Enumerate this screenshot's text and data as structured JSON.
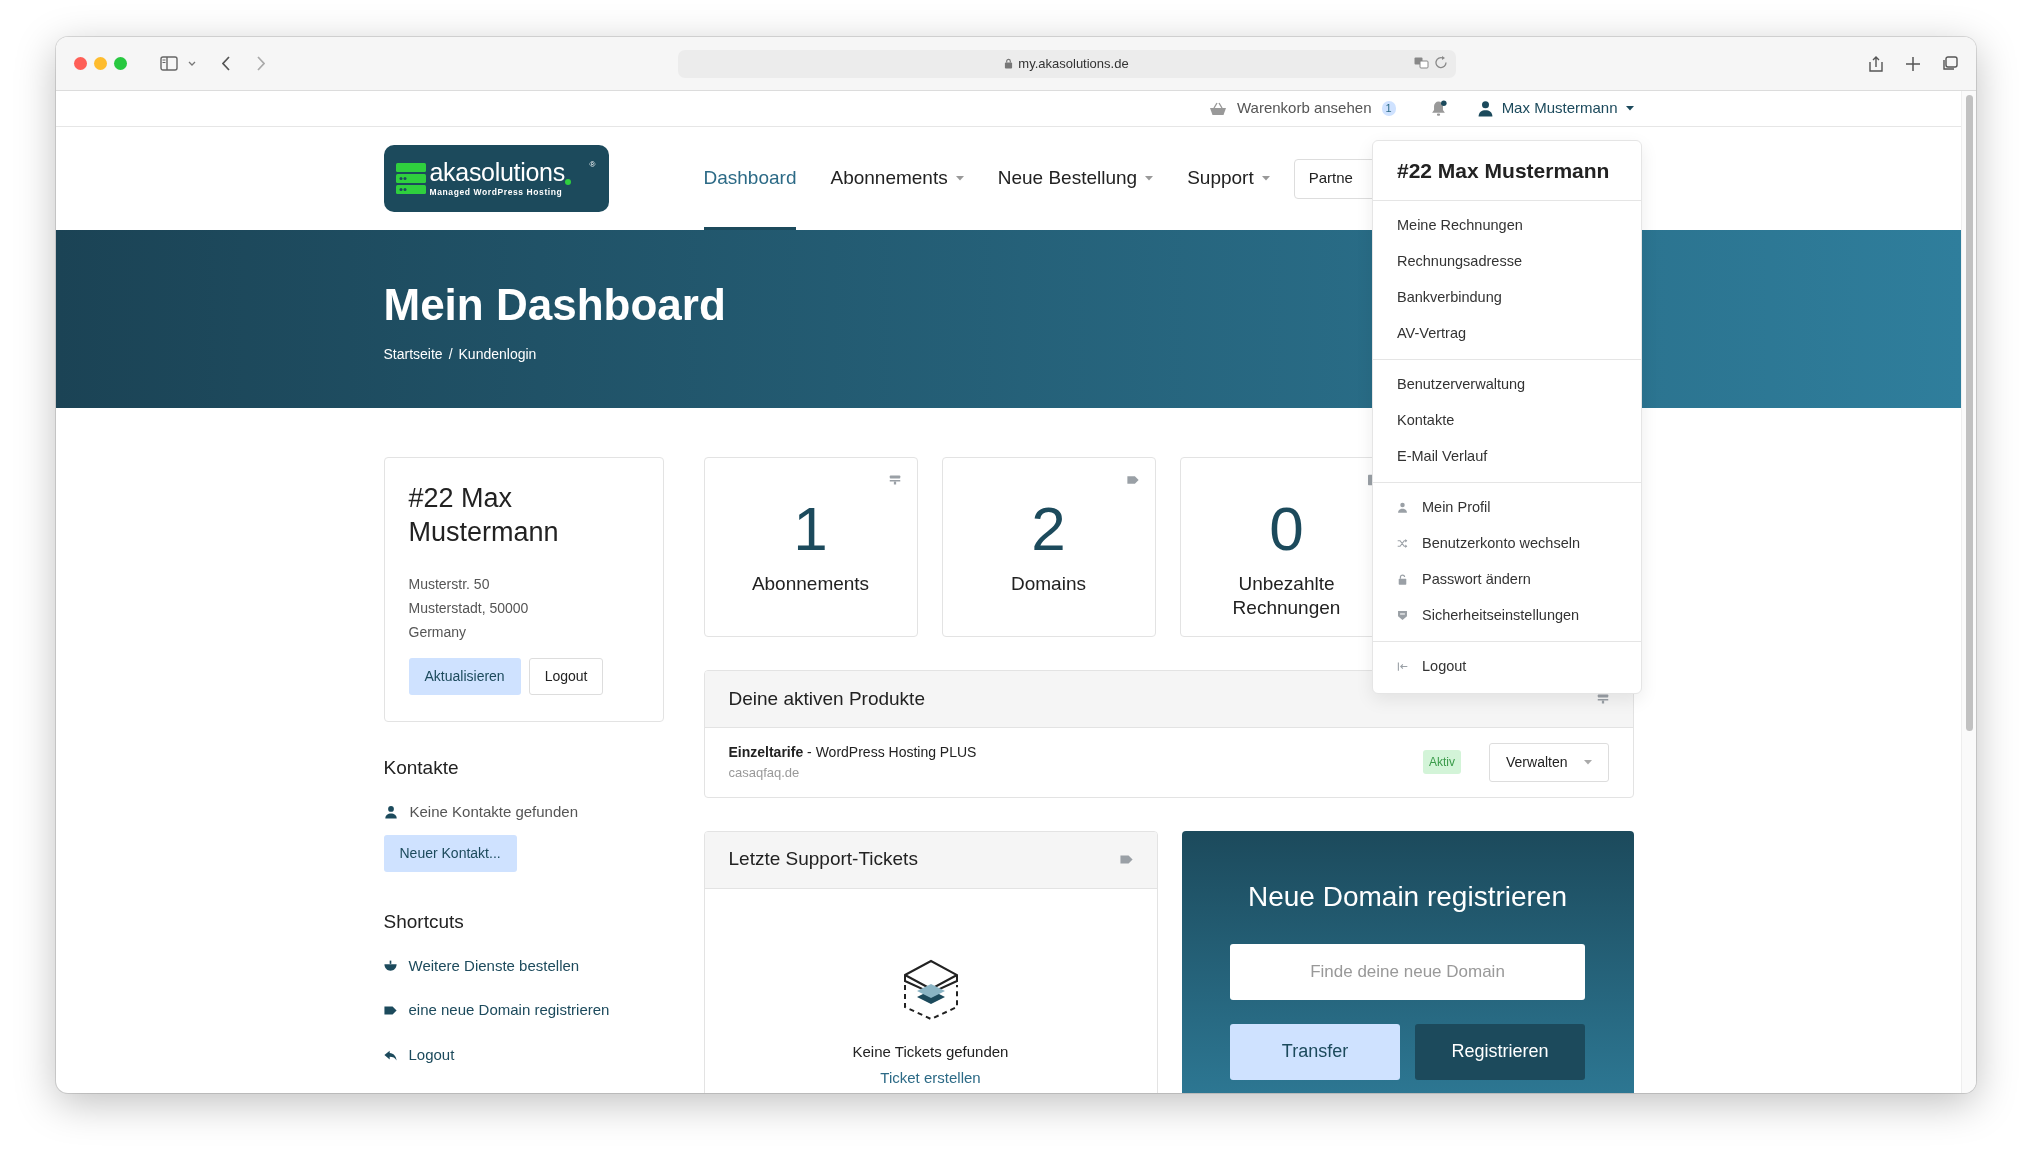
{
  "browser": {
    "url": "my.akasolutions.de"
  },
  "topbar": {
    "cart_label": "Warenkorb ansehen",
    "cart_count": "1",
    "user_name": "Max Mustermann"
  },
  "logo": {
    "name": "akasolutions",
    "registered": "®",
    "tagline": "Managed WordPress Hosting"
  },
  "nav": [
    {
      "label": "Dashboard",
      "selected": true,
      "dropdown": false
    },
    {
      "label": "Abonnements",
      "selected": false,
      "dropdown": true
    },
    {
      "label": "Neue Bestellung",
      "selected": false,
      "dropdown": true
    },
    {
      "label": "Support",
      "selected": false,
      "dropdown": true
    }
  ],
  "partner_button": "Partne",
  "hero": {
    "title": "Mein Dashboard",
    "breadcrumb": [
      "Startseite",
      "Kundenlogin"
    ],
    "separator": "/"
  },
  "profile": {
    "name": "#22 Max Mustermann",
    "address": [
      "Musterstr. 50",
      "Musterstadt, 50000",
      "Germany"
    ],
    "buttons": [
      {
        "label": "Aktualisieren",
        "kind": "primary"
      },
      {
        "label": "Logout",
        "kind": "outline"
      }
    ]
  },
  "contacts": {
    "title": "Kontakte",
    "empty": "Keine Kontakte gefunden",
    "button": "Neuer Kontakt..."
  },
  "shortcuts": {
    "title": "Shortcuts",
    "items": [
      {
        "label": "Weitere Dienste bestellen",
        "kind": "basket"
      },
      {
        "label": "eine neue Domain registrieren",
        "kind": "tag"
      },
      {
        "label": "Logout",
        "kind": "reply"
      }
    ]
  },
  "stats": [
    {
      "value": "1",
      "label": "Abonnements",
      "kind": "server"
    },
    {
      "value": "2",
      "label": "Domains",
      "kind": "tag"
    },
    {
      "value": "0",
      "label": "Unbezahlte Rechnungen",
      "kind": "doc"
    }
  ],
  "products": {
    "title": "Deine aktiven Produkte",
    "items": [
      {
        "name": "**Einzeltarife** - WordPress Hosting PLUS",
        "domain": "casaqfaq.de",
        "status": "Aktiv",
        "action": "Verwalten"
      }
    ]
  },
  "tickets": {
    "title": "Letzte Support-Tickets",
    "empty": "Keine Tickets gefunden",
    "link": "Ticket erstellen"
  },
  "domain": {
    "title": "Neue Domain registrieren",
    "placeholder": "Finde deine neue Domain",
    "buttons": [
      {
        "label": "Transfer",
        "kind": "light"
      },
      {
        "label": "Registrieren",
        "kind": "dark"
      }
    ]
  },
  "user_menu": {
    "title": "#22 Max Mustermann",
    "groups": [
      {
        "items": [
          {
            "label": "Meine Rechnungen"
          },
          {
            "label": "Rechnungsadresse"
          },
          {
            "label": "Bankverbindung"
          },
          {
            "label": "AV-Vertrag"
          }
        ]
      },
      {
        "items": [
          {
            "label": "Benutzerverwaltung"
          },
          {
            "label": "Kontakte"
          },
          {
            "label": "E-Mail Verlauf"
          }
        ]
      },
      {
        "items": [
          {
            "label": "Mein Profil",
            "kind": "user"
          },
          {
            "label": "Benutzerkonto wechseln",
            "kind": "shuffle"
          },
          {
            "label": "Passwort ändern",
            "kind": "lock"
          },
          {
            "label": "Sicherheitseinstellungen",
            "kind": "shield"
          }
        ]
      },
      {
        "items": [
          {
            "label": "Logout",
            "kind": "logout"
          }
        ]
      }
    ]
  }
}
